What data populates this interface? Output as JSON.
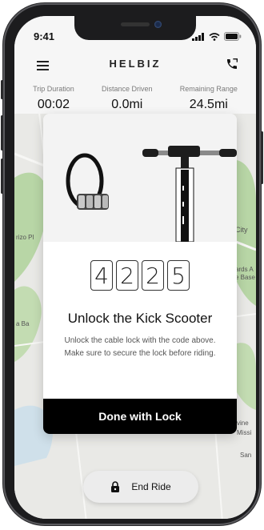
{
  "status": {
    "time": "9:41"
  },
  "header": {
    "brand": "HELBIZ"
  },
  "stats": [
    {
      "label": "Trip Duration",
      "value": "00:02"
    },
    {
      "label": "Distance Driven",
      "value": "0.0mi"
    },
    {
      "label": "Remaining Range",
      "value": "24.5mi"
    }
  ],
  "map": {
    "labels": [
      "rizo Pl",
      "a Ba",
      "City",
      "ards A",
      "e Base",
      "vine",
      "Missi",
      "San"
    ]
  },
  "modal": {
    "code_digits": [
      "4",
      "2",
      "2",
      "5"
    ],
    "title": "Unlock the Kick Scooter",
    "description": "Unlock the cable lock with the code above. Make sure to secure the lock before riding.",
    "done_label": "Done with Lock"
  },
  "end_ride": {
    "label": "End Ride"
  },
  "colors": {
    "primary": "#000000",
    "map_land": "#e9e9e6",
    "map_green": "#b8d6a6",
    "map_water": "#cfe0ea"
  }
}
